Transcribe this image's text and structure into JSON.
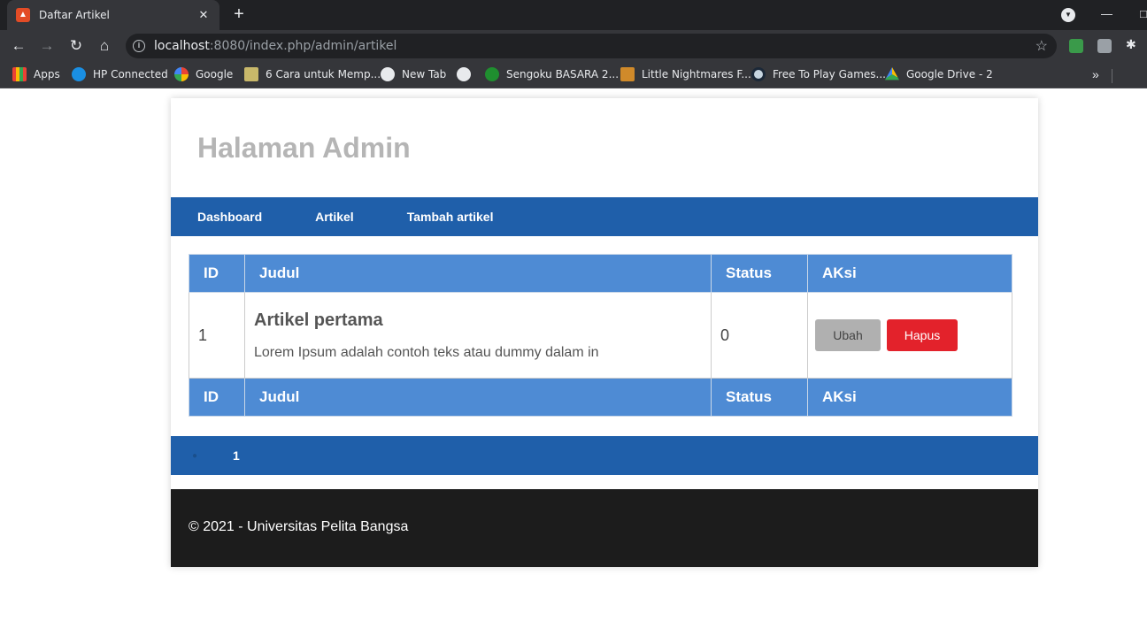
{
  "browser": {
    "tab_title": "Daftar Artikel",
    "url_host": "localhost",
    "url_path": ":8080/index.php/admin/artikel",
    "bookmarks": [
      {
        "label": "Apps",
        "color": "#ea4335"
      },
      {
        "label": "HP Connected",
        "color": "#1a8fe3"
      },
      {
        "label": "Google",
        "color": "#4285f4"
      },
      {
        "label": "6 Cara untuk Memp...",
        "color": "#c8b86a"
      },
      {
        "label": "New Tab",
        "color": "#e8eaed"
      },
      {
        "label": "",
        "color": "#e8eaed"
      },
      {
        "label": "Sengoku BASARA 2...",
        "color": "#1f8f2f"
      },
      {
        "label": "Little Nightmares F...",
        "color": "#d08a2a"
      },
      {
        "label": "Free To Play Games...",
        "color": "#1b2838"
      },
      {
        "label": "Google Drive - 2",
        "color": "#fbbc04"
      }
    ]
  },
  "header": {
    "title": "Halaman Admin"
  },
  "nav": {
    "dashboard": "Dashboard",
    "artikel": "Artikel",
    "tambah": "Tambah artikel"
  },
  "table": {
    "columns": [
      "ID",
      "Judul",
      "Status",
      "AKsi"
    ],
    "rows": [
      {
        "id": "1",
        "judul": "Artikel pertama",
        "excerpt": "Lorem Ipsum adalah contoh teks atau dummy dalam in",
        "status": "0",
        "ubah": "Ubah",
        "hapus": "Hapus"
      }
    ]
  },
  "pager": {
    "current": "1"
  },
  "footer": {
    "text": "© 2021 - Universitas Pelita Bangsa"
  },
  "colors": {
    "nav_blue": "#1f5faa",
    "header_blue": "#4e8bd4",
    "danger": "#e3222b",
    "footer": "#1c1c1c"
  }
}
